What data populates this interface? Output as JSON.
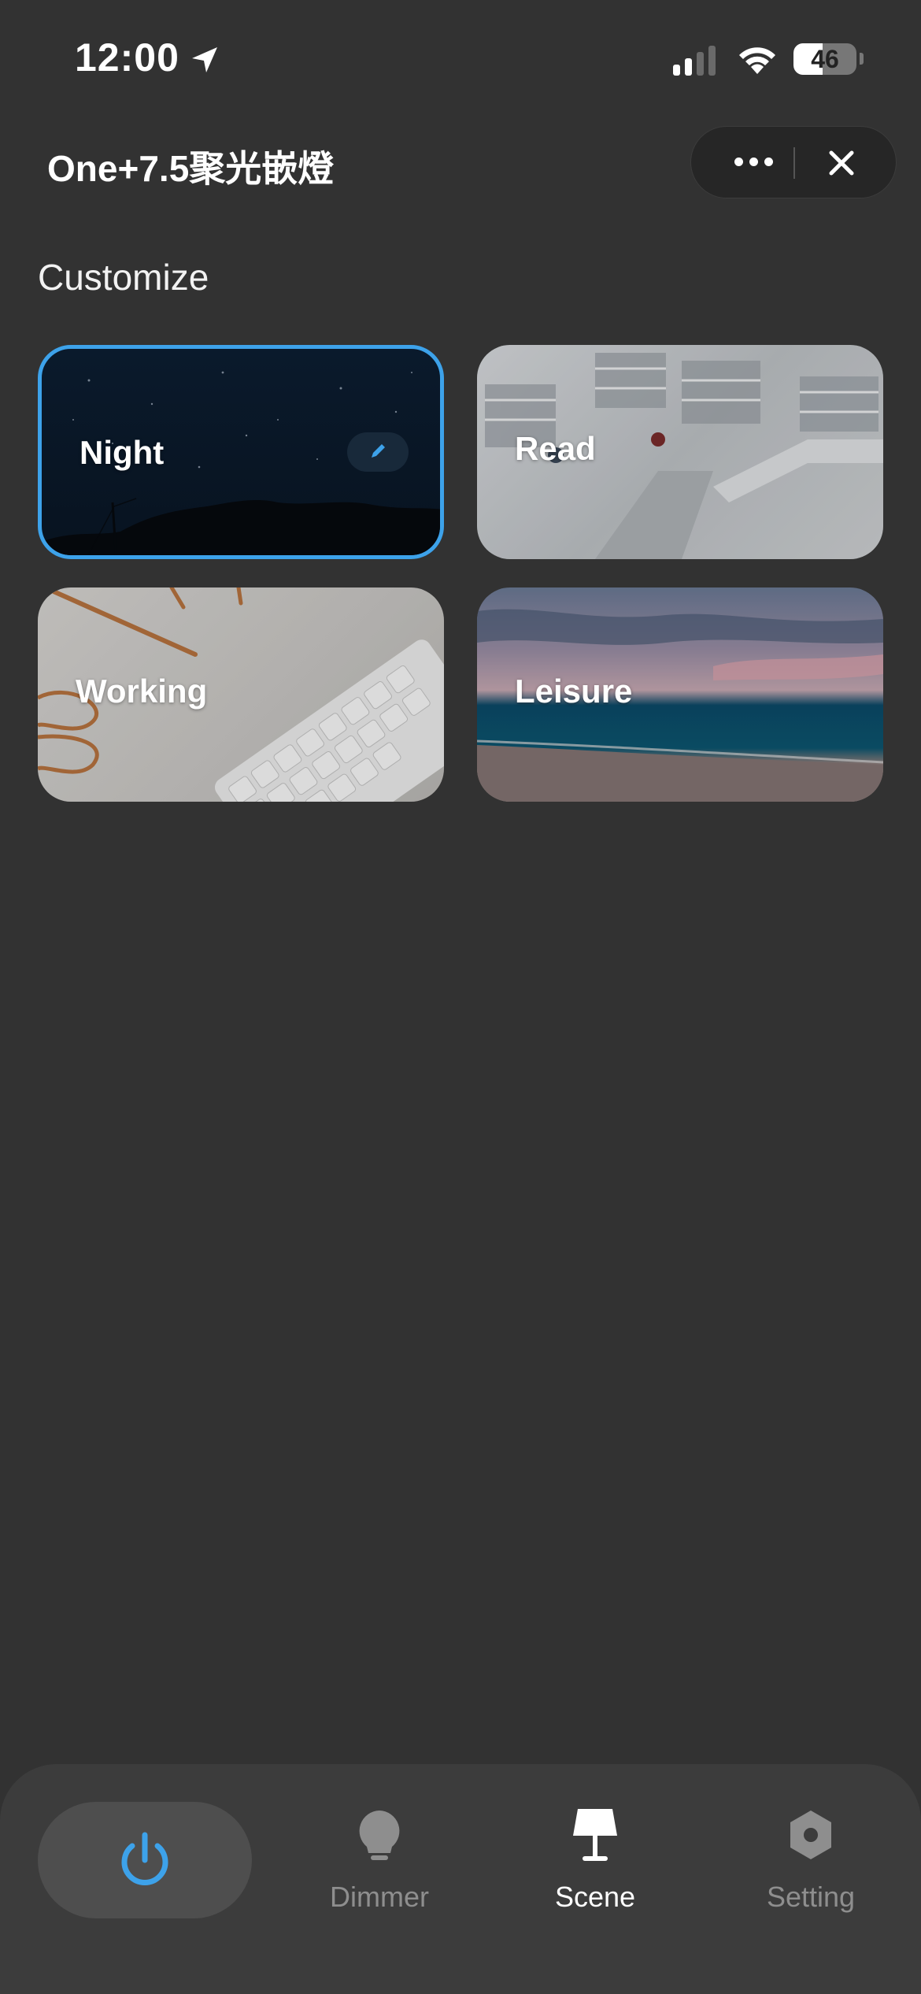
{
  "status_bar": {
    "time": "12:00",
    "battery_level": "46",
    "icons": [
      "location-arrow-icon",
      "cellular-signal-icon",
      "wifi-icon",
      "battery-icon"
    ]
  },
  "header": {
    "title": "One+7.5聚光嵌燈",
    "more_icon": "ellipsis-icon",
    "close_icon": "close-icon"
  },
  "section": {
    "title": "Customize"
  },
  "scenes": [
    {
      "label": "Night",
      "selected": true,
      "editable": true
    },
    {
      "label": "Read",
      "selected": false
    },
    {
      "label": "Working",
      "selected": false
    },
    {
      "label": "Leisure",
      "selected": false
    }
  ],
  "tabbar": {
    "power_icon": "power-icon",
    "tabs": [
      {
        "label": "Dimmer",
        "icon": "bulb-icon",
        "active": false
      },
      {
        "label": "Scene",
        "icon": "lamp-icon",
        "active": true
      },
      {
        "label": "Setting",
        "icon": "hex-gear-icon",
        "active": false
      }
    ]
  },
  "colors": {
    "background": "#323232",
    "accent": "#3da2ea",
    "tabbar": "#3c3c3c",
    "inactive_text": "#8e8e8e"
  }
}
